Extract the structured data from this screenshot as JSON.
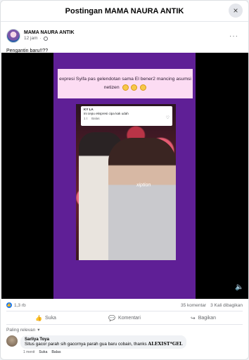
{
  "modal": {
    "title": "Postingan MAMA NAURA ANTIK",
    "close_icon": "×"
  },
  "post": {
    "page_name": "MAMA NAURA ANTIK",
    "time": "12 jam",
    "dot": "·",
    "caption": "Pengantin baru!!??",
    "more_icon": "···"
  },
  "video": {
    "text_card": "expresi Syifa pas gelendotan sama El bener2 mancing asumsi netizen",
    "comment_card": {
      "name": "KY LA",
      "text": "ini cepu ekspresi cipa kak udah",
      "time": "1 t",
      "reply": "Balas"
    },
    "watermark": "xiption",
    "volume_icon": "🔈"
  },
  "stats": {
    "likes": "1,3 rb",
    "comments": "35 komentar",
    "shares": "3 Kali dibagikan"
  },
  "actions": {
    "like": "Suka",
    "comment": "Komentari",
    "share": "Bagikan"
  },
  "filter": {
    "label": "Paling relevan",
    "chevron": "▾"
  },
  "comment": {
    "name": "Sarliya Toya",
    "text": "Situs gacor parah sih gacornya parah gua baru cobain, thanks",
    "brand": "ALEXIST*GEL",
    "time": "1 menit",
    "like": "Suka",
    "reply": "Balas"
  }
}
